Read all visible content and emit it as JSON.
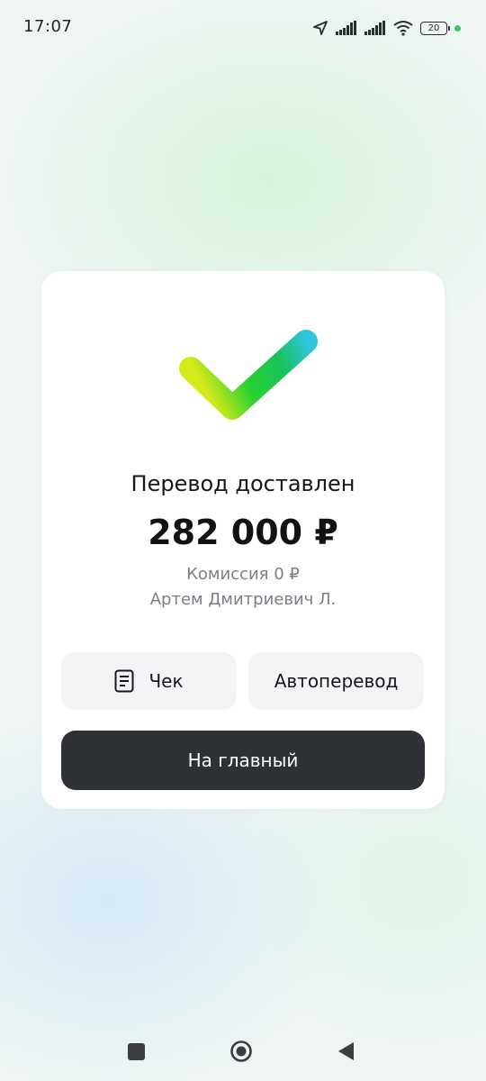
{
  "status_bar": {
    "time": "17:07",
    "battery_level": "20",
    "icons": [
      "navigation-arrow-icon",
      "signal-icon",
      "signal-icon",
      "wifi-icon",
      "battery-icon",
      "green-dot"
    ]
  },
  "result": {
    "title": "Перевод доставлен",
    "amount": "282 000 ₽",
    "commission": "Комиссия 0 ₽",
    "recipient": "Артем Дмитриевич Л."
  },
  "actions": {
    "receipt_label": "Чек",
    "auto_transfer_label": "Автоперевод",
    "home_label": "На главный"
  },
  "nav_bar": {
    "icons": [
      "recent-apps-icon",
      "home-icon",
      "back-icon"
    ]
  },
  "colors": {
    "accent_green": "#21c33b",
    "dark_button": "#2e3136",
    "status_dot": "#3ec46d"
  }
}
